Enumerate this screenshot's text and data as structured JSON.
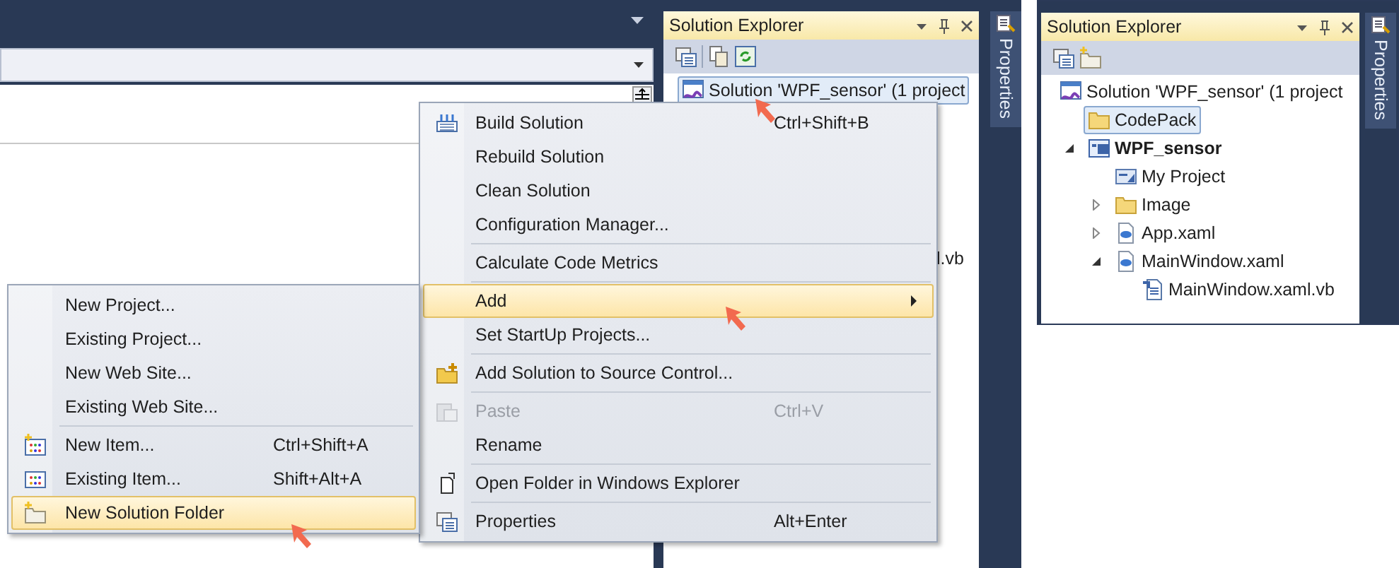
{
  "left_screenshot": {
    "solution_explorer": {
      "title": "Solution Explorer",
      "tree": [
        {
          "label": "Solution 'WPF_sensor' (1 project",
          "kind": "solution",
          "selected": true
        }
      ],
      "hidden_row_tail": "l.vb"
    },
    "properties_tab": "Properties",
    "context_menu": [
      [
        {
          "label": "Build Solution",
          "shortcut": "Ctrl+Shift+B",
          "kind": "build",
          "disabled": false,
          "selected": false
        },
        {
          "label": "Rebuild Solution",
          "kind": "plain",
          "disabled": false,
          "selected": false
        },
        {
          "label": "Clean Solution",
          "kind": "plain",
          "disabled": false,
          "selected": false
        },
        {
          "label": "Configuration Manager...",
          "kind": "plain",
          "disabled": false,
          "selected": false
        }
      ],
      [
        {
          "label": "Calculate Code Metrics",
          "kind": "plain",
          "disabled": false,
          "selected": false
        }
      ],
      [
        {
          "label": "Add",
          "kind": "submenu",
          "disabled": false,
          "selected": true
        },
        {
          "label": "Set StartUp Projects...",
          "kind": "plain",
          "disabled": false,
          "selected": false
        }
      ],
      [
        {
          "label": "Add Solution to Source Control...",
          "kind": "sourcecontrol",
          "disabled": false,
          "selected": false
        }
      ],
      [
        {
          "label": "Paste",
          "shortcut": "Ctrl+V",
          "kind": "paste",
          "disabled": true,
          "selected": false
        },
        {
          "label": "Rename",
          "kind": "plain",
          "disabled": false,
          "selected": false
        }
      ],
      [
        {
          "label": "Open Folder in Windows Explorer",
          "kind": "explorer",
          "disabled": false,
          "selected": false
        }
      ],
      [
        {
          "label": "Properties",
          "shortcut": "Alt+Enter",
          "kind": "properties",
          "disabled": false,
          "selected": false
        }
      ]
    ],
    "add_submenu": [
      [
        {
          "label": "New Project...",
          "kind": "plain",
          "disabled": false,
          "selected": false
        },
        {
          "label": "Existing Project...",
          "kind": "plain",
          "disabled": false,
          "selected": false
        },
        {
          "label": "New Web Site...",
          "kind": "plain",
          "disabled": false,
          "selected": false
        },
        {
          "label": "Existing Web Site...",
          "kind": "plain",
          "disabled": false,
          "selected": false
        }
      ],
      [
        {
          "label": "New Item...",
          "shortcut": "Ctrl+Shift+A",
          "kind": "newitem",
          "disabled": false,
          "selected": false
        },
        {
          "label": "Existing Item...",
          "shortcut": "Shift+Alt+A",
          "kind": "existingitem",
          "disabled": false,
          "selected": false
        },
        {
          "label": "New Solution Folder",
          "kind": "newfolder",
          "disabled": false,
          "selected": true
        }
      ]
    ]
  },
  "right_screenshot": {
    "solution_explorer": {
      "title": "Solution Explorer",
      "tree": [
        {
          "label": "Solution 'WPF_sensor' (1 project",
          "kind": "solution",
          "selected": false,
          "children": [
            {
              "label": "CodePack",
              "kind": "folder",
              "selected": true
            },
            {
              "label": "WPF_sensor",
              "kind": "project",
              "selected": false,
              "expanded": true,
              "children": [
                {
                  "label": "My Project",
                  "kind": "myproject",
                  "selected": false
                },
                {
                  "label": "Image",
                  "kind": "folder",
                  "selected": false,
                  "expanded": false
                },
                {
                  "label": "App.xaml",
                  "kind": "xaml",
                  "selected": false,
                  "expanded": false
                },
                {
                  "label": "MainWindow.xaml",
                  "kind": "xaml",
                  "selected": false,
                  "expanded": true,
                  "children": [
                    {
                      "label": "MainWindow.xaml.vb",
                      "kind": "vb",
                      "selected": false
                    }
                  ]
                }
              ]
            }
          ]
        }
      ]
    },
    "properties_tab": "Properties"
  }
}
